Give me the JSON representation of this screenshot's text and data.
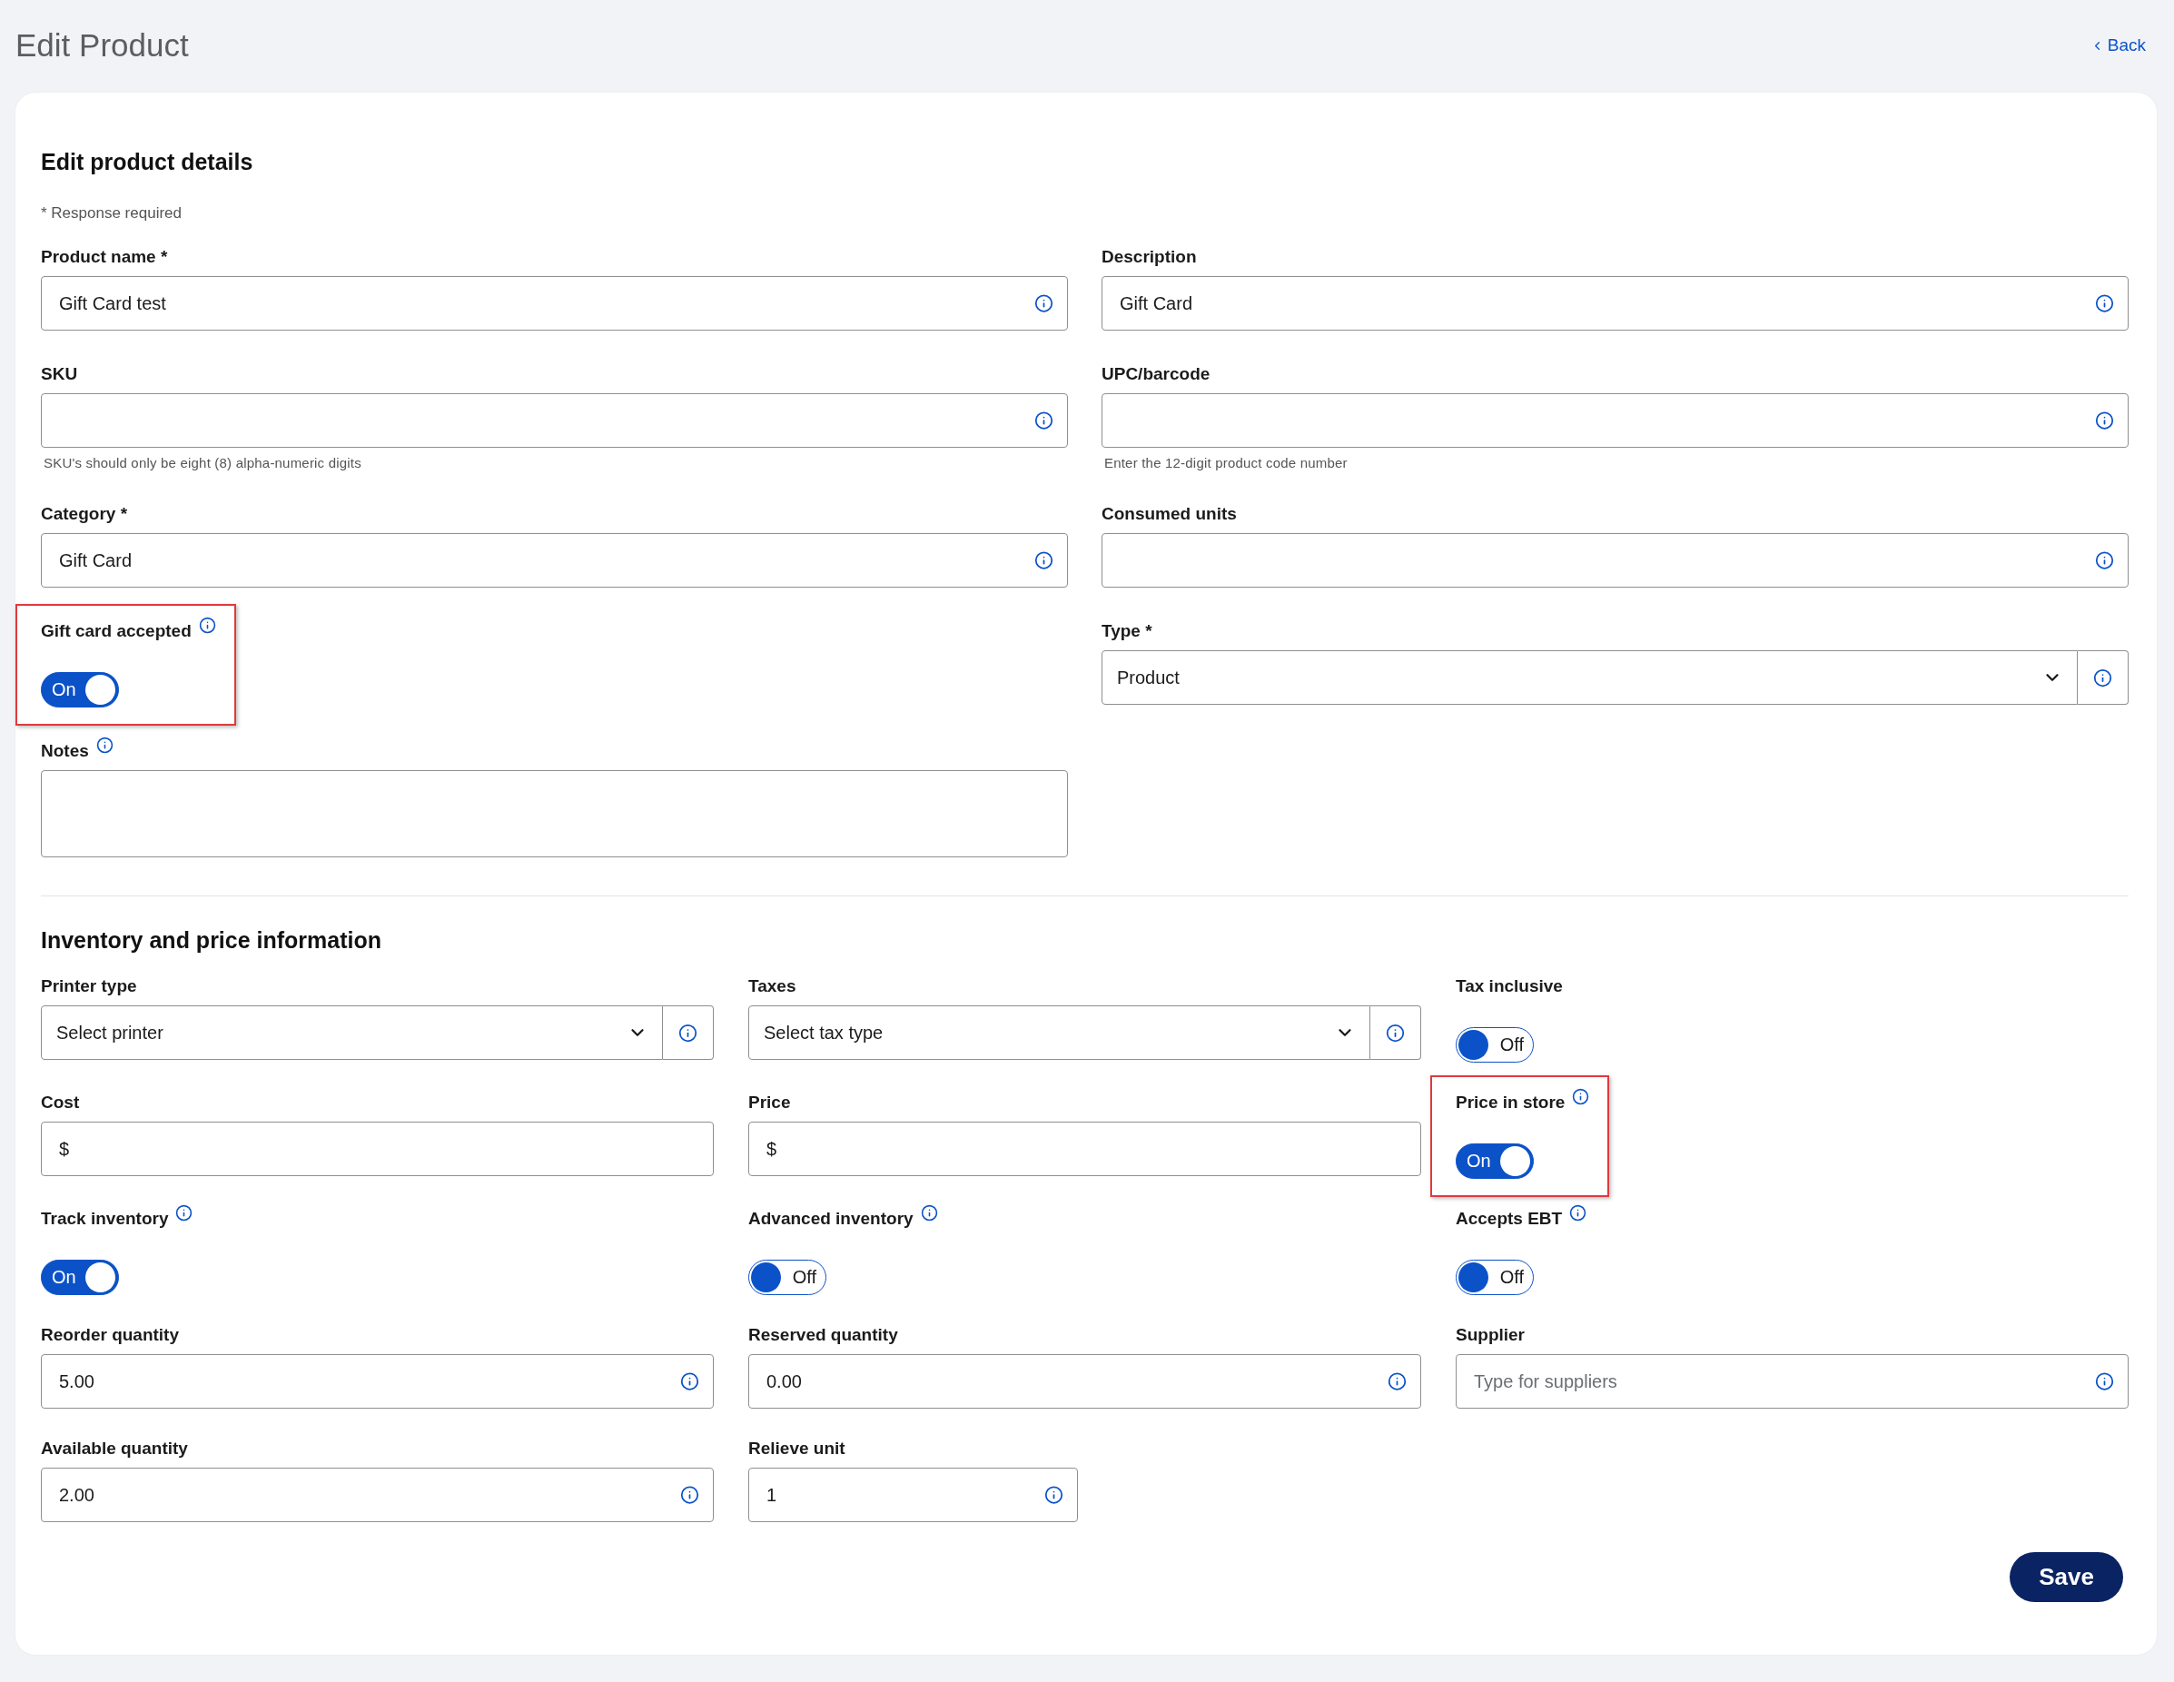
{
  "page": {
    "title": "Edit Product",
    "back_link": "Back"
  },
  "details": {
    "heading": "Edit product details",
    "required_note": "* Response required",
    "fields": [
      {
        "kind": "text",
        "label": "Product name *",
        "value": "Gift Card test",
        "info": true
      },
      {
        "kind": "text",
        "label": "Description",
        "value": "Gift Card",
        "info": true
      },
      {
        "kind": "text",
        "label": "SKU",
        "info": true,
        "helper": "SKU's should only be eight (8) alpha-numeric digits"
      },
      {
        "kind": "text",
        "label": "UPC/barcode",
        "info": true,
        "helper": "Enter the 12-digit product code number"
      },
      {
        "kind": "text",
        "label": "Category *",
        "value": "Gift Card",
        "info": true
      },
      {
        "kind": "text",
        "label": "Consumed units",
        "info": true
      },
      {
        "kind": "toggle",
        "label": "Gift card accepted",
        "label_info": true,
        "on": true,
        "state_text": "On",
        "highlighted": true
      },
      {
        "kind": "select",
        "label": "Type *",
        "value": "Product",
        "info": true
      },
      {
        "kind": "textarea",
        "label": "Notes",
        "label_info": true
      }
    ]
  },
  "inventory": {
    "heading": "Inventory and price information",
    "fields": [
      {
        "kind": "select",
        "label": "Printer type",
        "value": "Select printer",
        "info": true
      },
      {
        "kind": "select",
        "label": "Taxes",
        "value": "Select tax type",
        "info": true
      },
      {
        "kind": "toggle",
        "label": "Tax inclusive",
        "label_info": false,
        "on": false,
        "state_text": "Off",
        "highlighted": false
      },
      {
        "kind": "text",
        "label": "Cost",
        "value": "$",
        "info": false
      },
      {
        "kind": "text",
        "label": "Price",
        "value": "$",
        "info": false
      },
      {
        "kind": "toggle",
        "label": "Price in store",
        "label_info": true,
        "on": true,
        "state_text": "On",
        "highlighted": true
      },
      {
        "kind": "toggle",
        "label": "Track inventory",
        "label_info": true,
        "on": true,
        "state_text": "On",
        "highlighted": false
      },
      {
        "kind": "toggle",
        "label": "Advanced inventory",
        "label_info": true,
        "on": false,
        "state_text": "Off",
        "highlighted": false
      },
      {
        "kind": "toggle",
        "label": "Accepts EBT",
        "label_info": true,
        "on": false,
        "state_text": "Off",
        "highlighted": false
      },
      {
        "kind": "text",
        "label": "Reorder quantity",
        "value": "5.00",
        "info": true
      },
      {
        "kind": "text",
        "label": "Reserved quantity",
        "value": "0.00",
        "info": true
      },
      {
        "kind": "text",
        "label": "Supplier",
        "placeholder": "Type for suppliers",
        "info": true
      },
      {
        "kind": "text",
        "label": "Available quantity",
        "value": "2.00",
        "info": true
      },
      {
        "kind": "text",
        "label": "Relieve unit",
        "value": "1",
        "info": true,
        "narrow": true
      }
    ]
  },
  "save_button": "Save"
}
